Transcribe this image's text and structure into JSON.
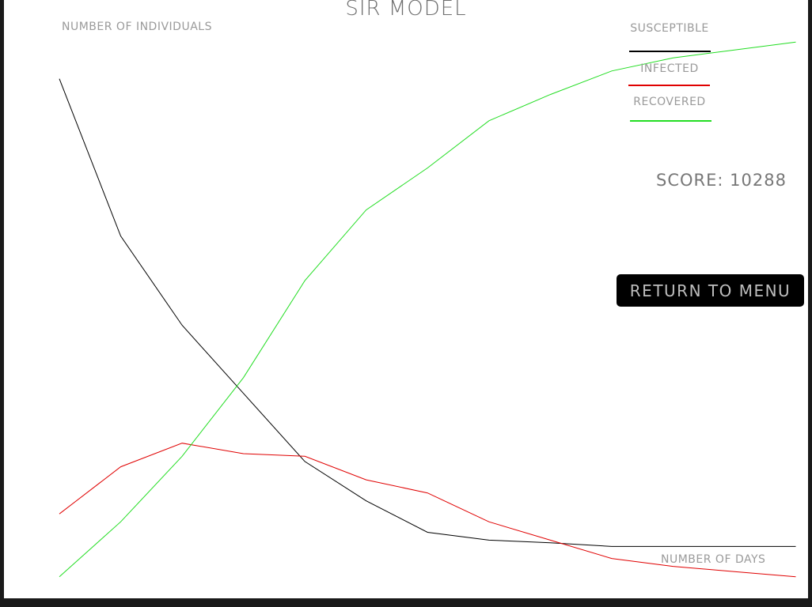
{
  "game": {
    "title": "SIR MODEL",
    "score_label": "SCORE:",
    "score_value": "10288",
    "menu_button_label": "RETURN TO MENU"
  },
  "legend": {
    "susceptible": "SUSCEPTIBLE",
    "infected": "INFECTED",
    "recovered": "RECOVERED"
  },
  "colors": {
    "background": "#ffffff",
    "frame": "#1a1a1a",
    "susceptible": "#000000",
    "infected": "#e00000",
    "recovered": "#22dd22",
    "label_text": "#9a9a9a",
    "button_bg": "#000000"
  },
  "chart_data": {
    "type": "line",
    "title": "SIR MODEL",
    "xlabel": "NUMBER OF DAYS",
    "ylabel": "NUMBER OF INDIVIDUALS",
    "x": [
      0,
      1,
      2,
      3,
      4,
      5,
      6,
      7,
      8,
      9,
      10,
      11,
      12
    ],
    "series": [
      {
        "name": "SUSCEPTIBLE",
        "color": "#000000",
        "values": [
          100,
          70,
          53,
          40,
          27,
          19.5,
          13.5,
          12,
          11.5,
          10.8,
          10.8,
          10.8,
          10.8
        ]
      },
      {
        "name": "INFECTED",
        "color": "#e00000",
        "values": [
          17,
          26,
          30.5,
          28.5,
          28,
          23.5,
          21,
          15.5,
          12,
          8.5,
          7,
          6,
          5
        ]
      },
      {
        "name": "RECOVERED",
        "color": "#22dd22",
        "values": [
          5,
          15.5,
          28,
          43,
          61.5,
          75,
          83,
          92,
          97,
          101.5,
          104,
          105.5,
          107
        ]
      }
    ],
    "xlim": [
      0,
      12.2
    ],
    "ylim": [
      0,
      107.5
    ],
    "grid": false,
    "legend_position": "top-right"
  }
}
